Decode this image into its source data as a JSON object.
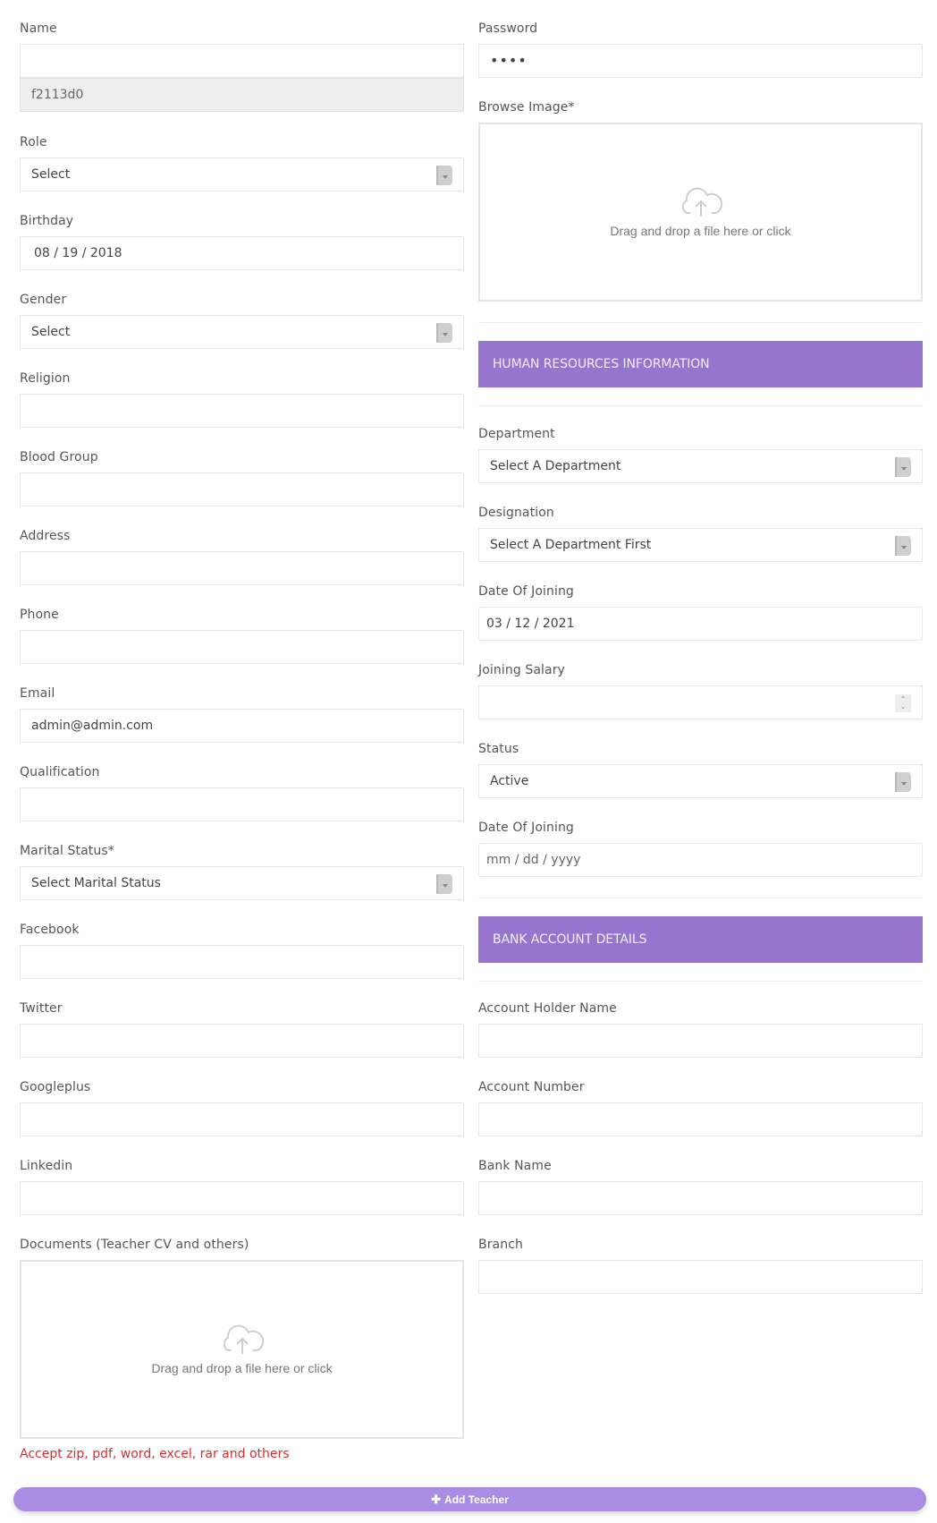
{
  "left": {
    "name": {
      "label": "Name",
      "value": "",
      "readonly_value": "f2113d0"
    },
    "role": {
      "label": "Role",
      "selected": "Select"
    },
    "birthday": {
      "label": "Birthday",
      "value": "08 / 19 / 2018"
    },
    "gender": {
      "label": "Gender",
      "selected": "Select"
    },
    "religion": {
      "label": "Religion",
      "value": ""
    },
    "blood_group": {
      "label": "Blood Group",
      "value": ""
    },
    "address": {
      "label": "Address",
      "value": ""
    },
    "phone": {
      "label": "Phone",
      "value": ""
    },
    "email": {
      "label": "Email",
      "value": "admin@admin.com"
    },
    "qualification": {
      "label": "Qualification",
      "value": ""
    },
    "marital_status": {
      "label": "Marital Status*",
      "selected": "Select Marital Status"
    },
    "facebook": {
      "label": "Facebook",
      "value": ""
    },
    "twitter": {
      "label": "Twitter",
      "value": ""
    },
    "googleplus": {
      "label": "Googleplus",
      "value": ""
    },
    "linkedin": {
      "label": "Linkedin",
      "value": ""
    },
    "documents": {
      "label": "Documents (Teacher CV and others)",
      "dropzone_text": "Drag and drop a file here or click",
      "hint": "Accept zip, pdf, word, excel, rar and others"
    }
  },
  "right": {
    "password": {
      "label": "Password",
      "value": "••••"
    },
    "image": {
      "label": "Browse Image*",
      "dropzone_text": "Drag and drop a file here or click"
    },
    "hr_section": {
      "title": "HUMAN RESOURCES INFORMATION"
    },
    "department": {
      "label": "Department",
      "selected": "Select A Department"
    },
    "designation": {
      "label": "Designation",
      "selected": "Select A Department First"
    },
    "date_of_joining": {
      "label": "Date Of Joining",
      "value": "03 / 12 / 2021"
    },
    "joining_salary": {
      "label": "Joining Salary",
      "value": ""
    },
    "status": {
      "label": "Status",
      "selected": "Active"
    },
    "date_of_joining_2": {
      "label": "Date Of Joining",
      "placeholder": "mm / dd / yyyy"
    },
    "bank_section": {
      "title": "BANK ACCOUNT DETAILS"
    },
    "account_holder_name": {
      "label": "Account Holder Name",
      "value": ""
    },
    "account_number": {
      "label": "Account Number",
      "value": ""
    },
    "bank_name": {
      "label": "Bank Name",
      "value": ""
    },
    "branch": {
      "label": "Branch",
      "value": ""
    }
  },
  "submit": {
    "icon": "plus-icon",
    "label": "Add Teacher"
  },
  "colors": {
    "accent": "#9575cd",
    "button": "#a98ce3",
    "hint": "#d32f2f"
  }
}
